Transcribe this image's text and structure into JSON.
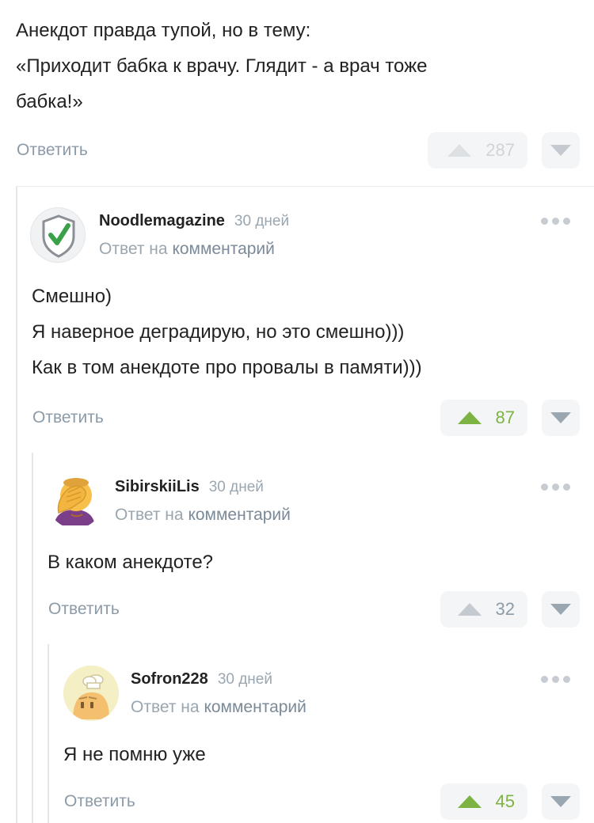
{
  "colors": {
    "accent_green": "#7cb342",
    "muted": "#8c9ba8",
    "vote_bg": "#f4f5f6",
    "thread_line": "#e4e6e8"
  },
  "top_comment": {
    "lines": [
      "Анекдот правда тупой, но в тему:",
      "«Приходит бабка к врачу. Глядит - а врач тоже",
      "бабка!»"
    ],
    "reply_label": "Ответить",
    "rating": "287"
  },
  "comments": [
    {
      "author": "Noodlemagazine",
      "date": "30 дней",
      "reply_to_prefix": "Ответ на",
      "reply_to_link": "комментарий",
      "avatar_icon": "shield-check-icon",
      "lines": [
        "Смешно)",
        "Я наверное деградирую, но это смешно)))",
        "Как в том анекдоте про провалы в памяти)))"
      ],
      "reply_label": "Ответить",
      "rating": "87"
    },
    {
      "author": "SibirskiiLis",
      "date": "30 дней",
      "reply_to_prefix": "Ответ на",
      "reply_to_link": "комментарий",
      "avatar_icon": "facepalm-emoji-icon",
      "lines": [
        "В каком анекдоте?"
      ],
      "reply_label": "Ответить",
      "rating": "32"
    },
    {
      "author": "Sofron228",
      "date": "30 дней",
      "reply_to_prefix": "Ответ на",
      "reply_to_link": "комментарий",
      "avatar_icon": "chef-avatar-icon",
      "lines": [
        "Я не помню уже"
      ],
      "reply_label": "Ответить",
      "rating": "45"
    }
  ]
}
